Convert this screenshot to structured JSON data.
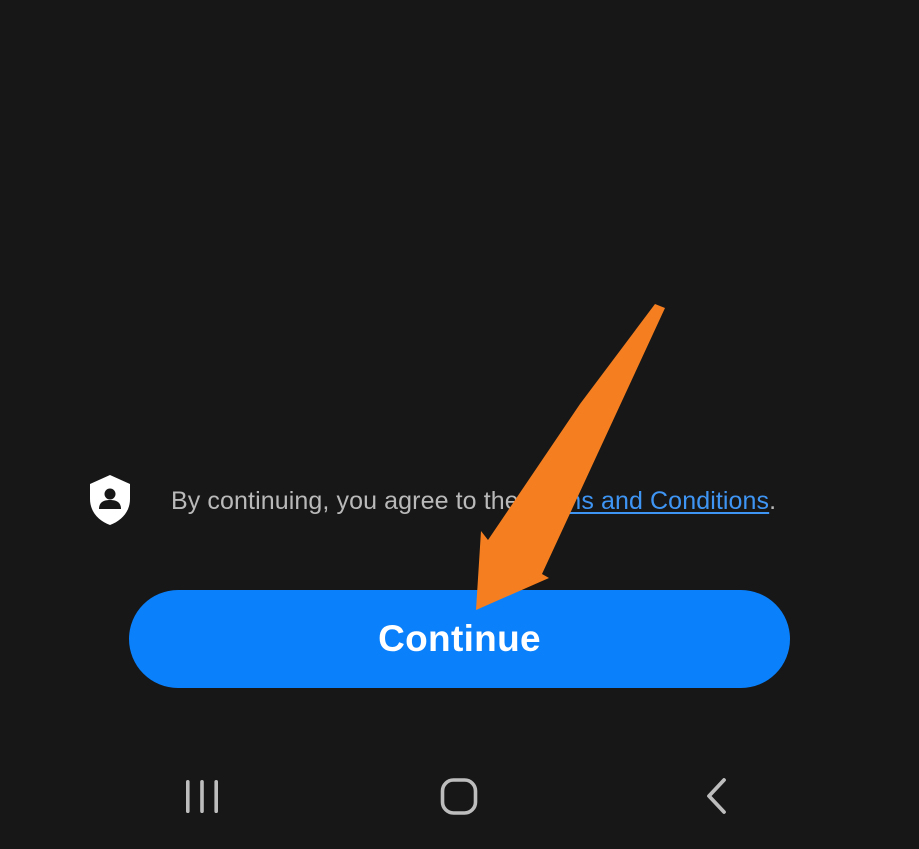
{
  "terms": {
    "prefix": "By continuing, you agree to the ",
    "link_label": "Terms and Conditions",
    "suffix": "."
  },
  "continue_button": {
    "label": "Continue"
  },
  "navigation_bar": {
    "recents_icon": "recents-icon",
    "home_icon": "home-icon",
    "back_icon": "back-icon"
  },
  "annotation": {
    "arrow_color": "#f57f20"
  },
  "colors": {
    "background": "#171717",
    "button": "#0a80fb",
    "link": "#3f95f4",
    "text": "#b9b9b9"
  }
}
